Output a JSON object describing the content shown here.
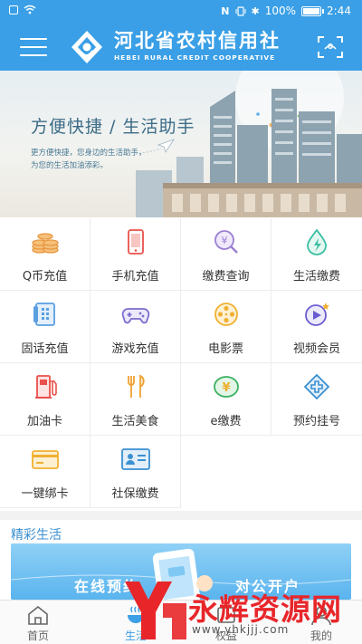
{
  "status_bar": {
    "battery": "100%",
    "time": "2:44"
  },
  "header": {
    "title": "河北省农村信用社",
    "subtitle": "HEBEI RURAL CREDIT COOPERATIVE"
  },
  "banner": {
    "title": "方便快捷 / 生活助手",
    "sub_line1": "更方便快捷，您身边的生活助手，",
    "sub_line2": "为您的生活加油添彩。"
  },
  "services": [
    {
      "label": "Q币充值",
      "icon": "coins-icon",
      "color": "#f0a050"
    },
    {
      "label": "手机充值",
      "icon": "phone-icon",
      "color": "#e9504a"
    },
    {
      "label": "缴费查询",
      "icon": "fee-search-icon",
      "color": "#9b7fd4"
    },
    {
      "label": "生活缴费",
      "icon": "water-drop-icon",
      "color": "#3bbfa2"
    },
    {
      "label": "固话充值",
      "icon": "landline-icon",
      "color": "#5a9fe0"
    },
    {
      "label": "游戏充值",
      "icon": "gamepad-icon",
      "color": "#7a6cd0"
    },
    {
      "label": "电影票",
      "icon": "film-reel-icon",
      "color": "#f0b030"
    },
    {
      "label": "视频会员",
      "icon": "video-play-icon",
      "color": "#6a5cd0"
    },
    {
      "label": "加油卡",
      "icon": "fuel-icon",
      "color": "#e9504a"
    },
    {
      "label": "生活美食",
      "icon": "fork-knife-icon",
      "color": "#f0a030"
    },
    {
      "label": "e缴费",
      "icon": "e-pay-icon",
      "color": "#3bb060"
    },
    {
      "label": "预约挂号",
      "icon": "medical-cross-icon",
      "color": "#3a8fd0"
    },
    {
      "label": "一键绑卡",
      "icon": "bank-card-icon",
      "color": "#f0b030"
    },
    {
      "label": "社保缴费",
      "icon": "id-card-icon",
      "color": "#3a8fd0"
    }
  ],
  "section": {
    "title": "精彩生活",
    "left_text": "在线预约",
    "right_text": "对公开户"
  },
  "bottom_nav": [
    {
      "label": "首页",
      "icon": "home-icon"
    },
    {
      "label": "生活",
      "icon": "life-icon"
    },
    {
      "label": "权益",
      "icon": "rights-icon"
    },
    {
      "label": "我的",
      "icon": "profile-icon"
    }
  ],
  "watermark": {
    "text": "永辉资源网",
    "url": "www.yhkjjj.com"
  }
}
